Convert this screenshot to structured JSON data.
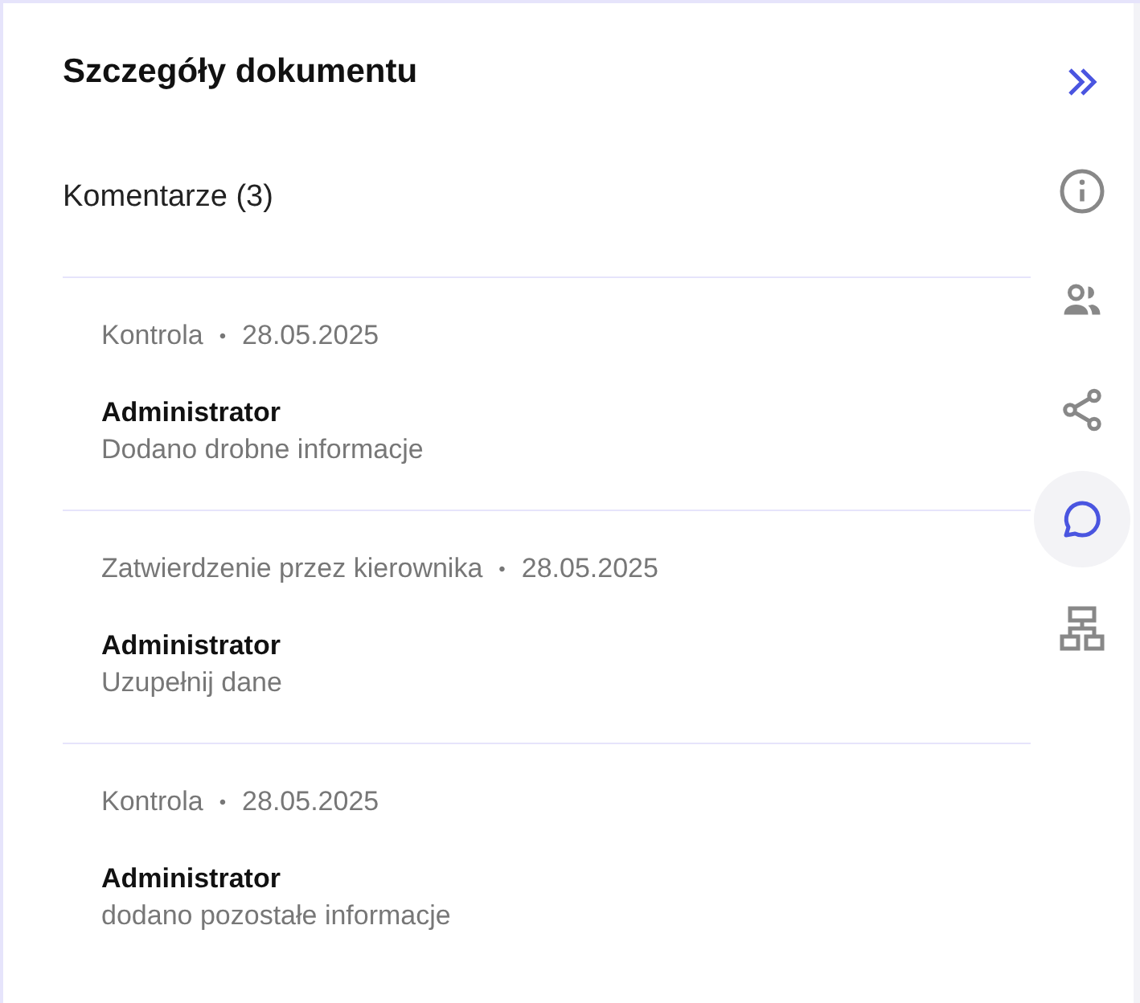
{
  "panel": {
    "title": "Szczegóły dokumentu",
    "section_title": "Komentarze (3)"
  },
  "comments": [
    {
      "step": "Kontrola",
      "separator": "•",
      "date": "28.05.2025",
      "author": "Administrator",
      "text": "Dodano drobne informacje"
    },
    {
      "step": "Zatwierdzenie przez kierownika",
      "separator": "•",
      "date": "28.05.2025",
      "author": "Administrator",
      "text": "Uzupełnij dane"
    },
    {
      "step": "Kontrola",
      "separator": "•",
      "date": "28.05.2025",
      "author": "Administrator",
      "text": "dodano pozostałe informacje"
    }
  ],
  "rail": [
    {
      "kind": "collapse",
      "selected": false
    },
    {
      "kind": "info",
      "selected": false
    },
    {
      "kind": "users",
      "selected": false
    },
    {
      "kind": "share",
      "selected": false
    },
    {
      "kind": "comments",
      "selected": true
    },
    {
      "kind": "workflow",
      "selected": false
    }
  ]
}
